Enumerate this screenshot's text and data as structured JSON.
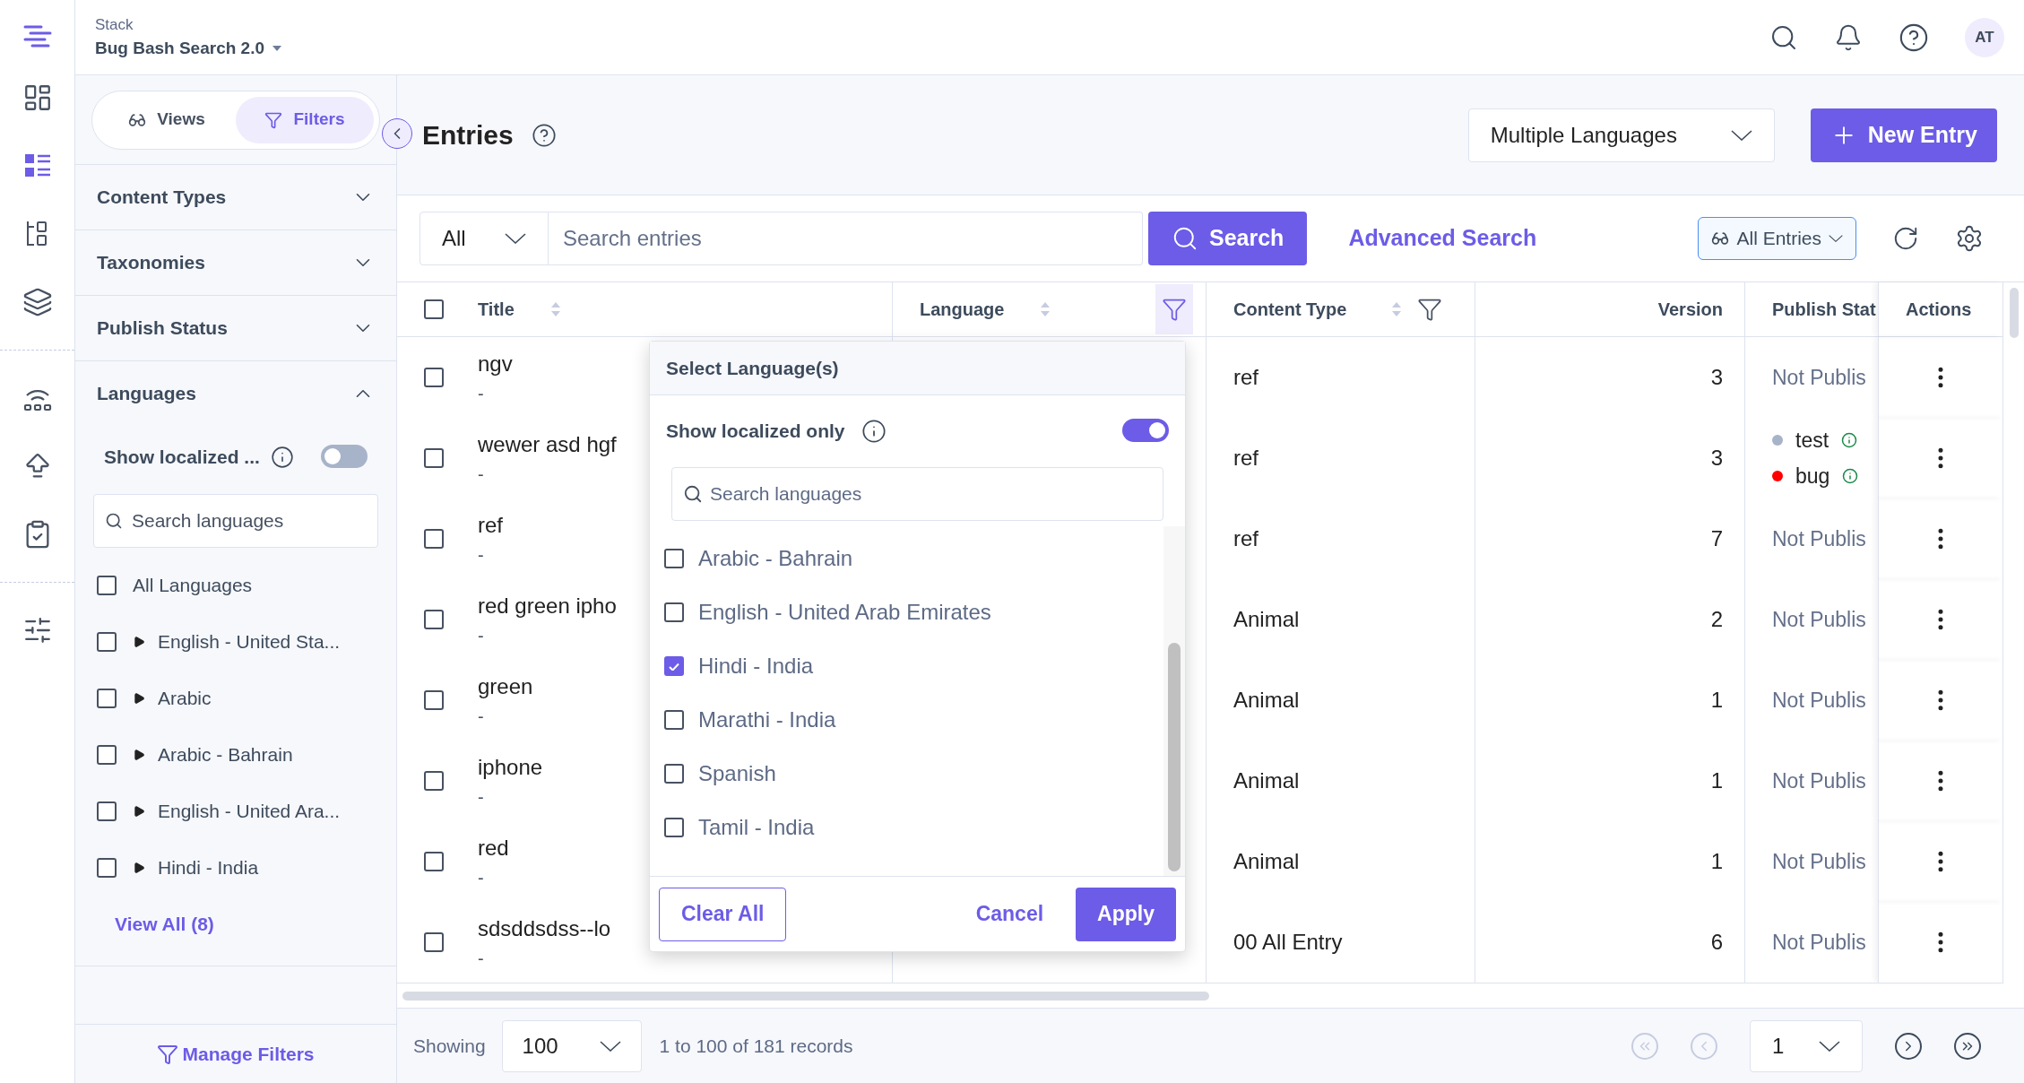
{
  "app": {
    "stack_label": "Stack",
    "stack_name": "Bug Bash Search 2.0",
    "avatar": "AT"
  },
  "nav_rail": {
    "groups": [
      {
        "items": [
          {
            "kind": "dashboard",
            "selected": false
          },
          {
            "kind": "entries",
            "selected": true
          },
          {
            "kind": "tree",
            "selected": false
          },
          {
            "kind": "layers",
            "selected": false
          }
        ]
      },
      {
        "items": [
          {
            "kind": "signal",
            "selected": false
          },
          {
            "kind": "upload",
            "selected": false
          },
          {
            "kind": "clipboard",
            "selected": false
          }
        ]
      },
      {
        "items": [
          {
            "kind": "sliders",
            "selected": false
          }
        ]
      }
    ]
  },
  "filter_panel": {
    "tabs": [
      {
        "label": "Views",
        "kind": "views",
        "selected": false
      },
      {
        "label": "Filters",
        "kind": "filters",
        "selected": true
      }
    ],
    "sections": [
      {
        "label": "Content Types",
        "expanded": false
      },
      {
        "label": "Taxonomies",
        "expanded": false
      },
      {
        "label": "Publish Status",
        "expanded": false
      },
      {
        "label": "Languages",
        "expanded": true
      }
    ],
    "languages": {
      "toggle_label": "Show localized ...",
      "localized_only": false,
      "search_placeholder": "Search languages",
      "items": [
        {
          "label": "All Languages",
          "checked": false,
          "expandable": false
        },
        {
          "label": "English - United Sta...",
          "checked": false,
          "expandable": true
        },
        {
          "label": "Arabic",
          "checked": false,
          "expandable": true
        },
        {
          "label": "Arabic - Bahrain",
          "checked": false,
          "expandable": true
        },
        {
          "label": "English - United Ara...",
          "checked": false,
          "expandable": true
        },
        {
          "label": "Hindi - India",
          "checked": false,
          "expandable": true
        }
      ],
      "view_all": "View All (8)"
    },
    "manage_filters": "Manage Filters"
  },
  "page": {
    "title": "Entries",
    "language_select": "Multiple Languages",
    "new_entry": "New Entry"
  },
  "search": {
    "scope": "All",
    "placeholder": "Search entries",
    "button": "Search",
    "advanced": "Advanced Search",
    "view_select": "All Entries"
  },
  "table": {
    "all_selected": false,
    "columns": [
      {
        "kind": "title",
        "label": "Title",
        "sortable": true
      },
      {
        "kind": "language",
        "label": "Language",
        "sortable": true,
        "filter_active": true
      },
      {
        "kind": "content_type",
        "label": "Content Type",
        "sortable": true,
        "filter_active": false
      },
      {
        "kind": "version",
        "label": "Version",
        "sortable": false
      },
      {
        "kind": "status",
        "label": "Publish Stat",
        "sortable": false
      },
      {
        "kind": "actions",
        "label": "Actions",
        "sortable": false
      }
    ],
    "rows": [
      {
        "selected": false,
        "title": "ngv",
        "subtitle": "-",
        "content_type": "ref",
        "version": "3",
        "status": {
          "kind": "text",
          "label": "Not Publis"
        }
      },
      {
        "selected": false,
        "title": "wewer asd hgf",
        "subtitle": "-",
        "content_type": "ref",
        "version": "3",
        "status": {
          "kind": "list",
          "items": [
            {
              "label": "test",
              "color": "#a7b3c9"
            },
            {
              "label": "bug",
              "color": "#ff0000"
            }
          ]
        }
      },
      {
        "selected": false,
        "title": "ref",
        "subtitle": "-",
        "content_type": "ref",
        "version": "7",
        "status": {
          "kind": "text",
          "label": "Not Publis"
        }
      },
      {
        "selected": false,
        "title": "red green ipho",
        "subtitle": "-",
        "content_type": "Animal",
        "version": "2",
        "status": {
          "kind": "text",
          "label": "Not Publis"
        }
      },
      {
        "selected": false,
        "title": "green",
        "subtitle": "-",
        "content_type": "Animal",
        "version": "1",
        "status": {
          "kind": "text",
          "label": "Not Publis"
        }
      },
      {
        "selected": false,
        "title": "iphone",
        "subtitle": "-",
        "content_type": "Animal",
        "version": "1",
        "status": {
          "kind": "text",
          "label": "Not Publis"
        }
      },
      {
        "selected": false,
        "title": "red",
        "subtitle": "-",
        "content_type": "Animal",
        "version": "1",
        "status": {
          "kind": "text",
          "label": "Not Publis"
        }
      },
      {
        "selected": false,
        "title": "sdsddsdss--lo",
        "subtitle": "-",
        "content_type": "00 All Entry",
        "version": "6",
        "status": {
          "kind": "text",
          "label": "Not Publis"
        }
      }
    ]
  },
  "language_popup": {
    "title": "Select Language(s)",
    "toggle_label": "Show localized only",
    "localized_only": true,
    "search_placeholder": "Search languages",
    "items": [
      {
        "label": "Arabic - Bahrain",
        "checked": false
      },
      {
        "label": "English - United Arab Emirates",
        "checked": false
      },
      {
        "label": "Hindi - India",
        "checked": true
      },
      {
        "label": "Marathi - India",
        "checked": false
      },
      {
        "label": "Spanish",
        "checked": false
      },
      {
        "label": "Tamil - India",
        "checked": false
      }
    ],
    "clear": "Clear All",
    "cancel": "Cancel",
    "apply": "Apply"
  },
  "footer": {
    "showing_label": "Showing",
    "page_size": "100",
    "range": "1 to 100 of 181 records",
    "page": "1",
    "pager": [
      {
        "kind": "first",
        "disabled": true
      },
      {
        "kind": "prev",
        "disabled": true
      },
      {
        "kind": "select"
      },
      {
        "kind": "next",
        "disabled": false
      },
      {
        "kind": "last",
        "disabled": false
      }
    ]
  }
}
